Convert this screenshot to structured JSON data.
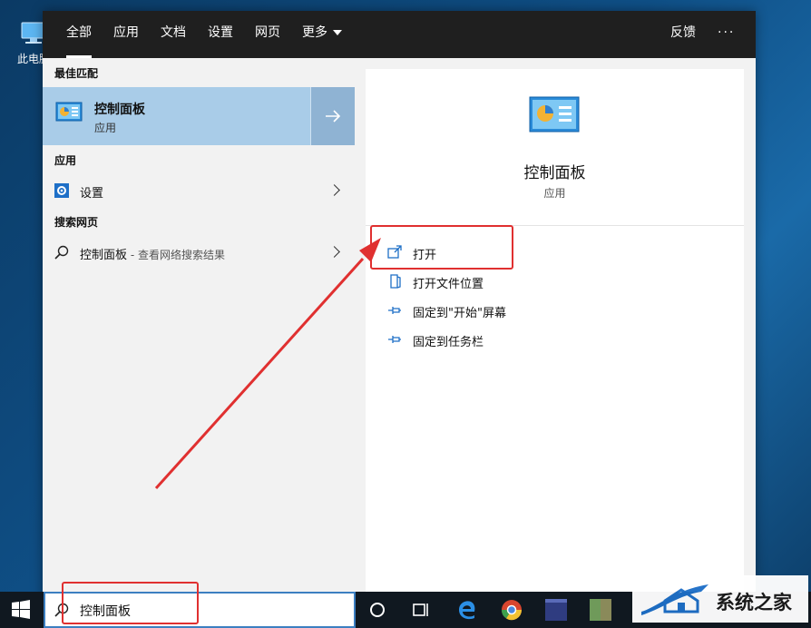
{
  "desktop": {
    "icon_label": "此电脑"
  },
  "search": {
    "tabs": [
      {
        "label": "全部",
        "active": true
      },
      {
        "label": "应用"
      },
      {
        "label": "文档"
      },
      {
        "label": "设置"
      },
      {
        "label": "网页"
      },
      {
        "label": "更多"
      }
    ],
    "feedback_label": "反馈",
    "more_options_label": "···",
    "best_match_header": "最佳匹配",
    "best_match": {
      "title": "控制面板",
      "subtitle": "应用"
    },
    "apps_header": "应用",
    "apps": [
      {
        "label": "设置"
      }
    ],
    "web_header": "搜索网页",
    "web_result": {
      "label": "控制面板",
      "suffix": " - 查看网络搜索结果"
    },
    "detail": {
      "title": "控制面板",
      "subtitle": "应用"
    },
    "actions": [
      {
        "label": "打开",
        "icon": "open-icon"
      },
      {
        "label": "打开文件位置",
        "icon": "folder-location-icon"
      },
      {
        "label": "固定到\"开始\"屏幕",
        "icon": "pin-icon"
      },
      {
        "label": "固定到任务栏",
        "icon": "pin-icon"
      }
    ],
    "query": "控制面板"
  },
  "watermark": {
    "text": "系统之家"
  },
  "colors": {
    "accent": "#3c7fc1",
    "selected": "#a9cce8",
    "annotation": "#e03030"
  }
}
